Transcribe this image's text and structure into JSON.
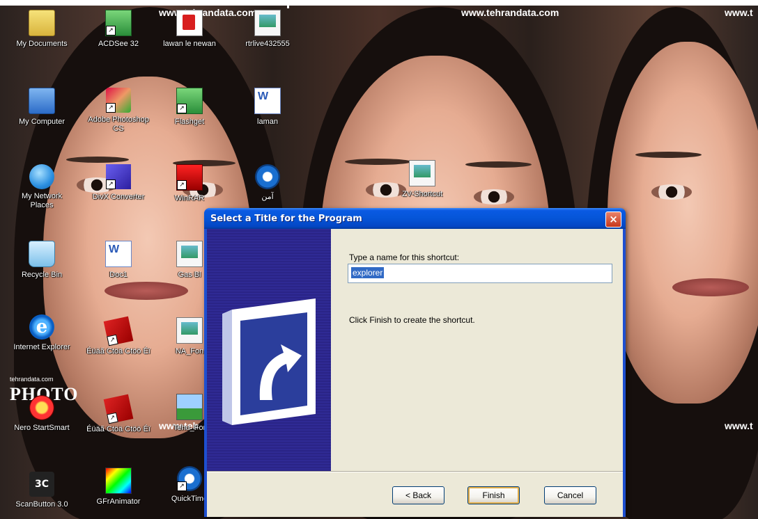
{
  "wallpaper": {
    "watermarks": [
      "www.tehrandata.com",
      "www.tehrandata.com",
      "www.t",
      "www.teh",
      "www.t"
    ],
    "photo_logo": "PHOTO",
    "photo_logo_caption": "tehrandata.com"
  },
  "desktop_icons": [
    {
      "label": "My Documents",
      "icon": "my-documents-icon"
    },
    {
      "label": "ACDSee 32",
      "icon": "acdsee-icon"
    },
    {
      "label": "lawan le newan",
      "icon": "pdf-icon"
    },
    {
      "label": "rtrlive432555",
      "icon": "media-file-icon"
    },
    {
      "label": "My Computer",
      "icon": "my-computer-icon"
    },
    {
      "label": "Adobe Photoshop CS",
      "icon": "photoshop-icon"
    },
    {
      "label": "Flashget",
      "icon": "flashget-icon"
    },
    {
      "label": "laman",
      "icon": "word-document-icon"
    },
    {
      "label": "My Network Places",
      "icon": "network-places-icon"
    },
    {
      "label": "DivX Converter",
      "icon": "purple-app-icon"
    },
    {
      "label": "WinRAR",
      "icon": "red-archive-icon"
    },
    {
      "label": "آمن",
      "icon": "blue-circle-icon"
    },
    {
      "label": "ZV-Shortcut",
      "icon": "document-icon"
    },
    {
      "label": "Recycle Bin",
      "icon": "recycle-bin-icon"
    },
    {
      "label": "Doc1",
      "icon": "word-document-icon"
    },
    {
      "label": "Gas Bl",
      "icon": "media-file-icon"
    },
    {
      "label": "Internet Explorer",
      "icon": "internet-explorer-icon"
    },
    {
      "label": "Éüäã  Ctöä Ctöö Éï",
      "icon": "flash-icon"
    },
    {
      "label": "NA_Fon",
      "icon": "media-file-icon"
    },
    {
      "label": "Nero StartSmart",
      "icon": "nero-icon"
    },
    {
      "label": "Éüäã Ctöä Ctöö Éï",
      "icon": "flash-icon"
    },
    {
      "label": "Tehu_For",
      "icon": "image-file-icon"
    },
    {
      "label": "ScanButton 3.0",
      "icon": "scanbutton-icon"
    },
    {
      "label": "GFrAnimator",
      "icon": "color-palette-icon"
    },
    {
      "label": "QuickTime",
      "icon": "quicktime-icon"
    }
  ],
  "dialog": {
    "title": "Select a Title for the Program",
    "close_label": "×",
    "prompt": "Type a name for this shortcut:",
    "shortcut_name": "explorer",
    "finish_hint": "Click Finish to create the shortcut.",
    "buttons": {
      "back": "< Back",
      "finish": "Finish",
      "cancel": "Cancel"
    }
  },
  "colors": {
    "titlebar": "#0555d8",
    "dialog_face": "#ece9d8",
    "banner": "#2a2487",
    "selection": "#316ac5",
    "close_button": "#c8371b"
  }
}
